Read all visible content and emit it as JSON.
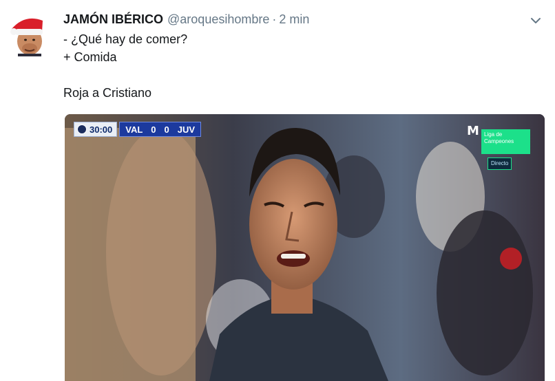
{
  "tweet": {
    "display_name": "JAMÓN IBÉRICO",
    "handle": "@aroquesihombre",
    "separator": "·",
    "time": "2 min",
    "lines": [
      "- ¿Qué hay de comer?",
      "+ Comida",
      "",
      "Roja a Cristiano"
    ]
  },
  "icons": {
    "avatar": "santa-hat-avatar",
    "menu": "chevron-down-icon"
  },
  "media": {
    "scorebug": {
      "clock": "30:00",
      "home": "VAL",
      "home_score": "0",
      "away_score": "0",
      "away": "JUV"
    },
    "broadcaster_logo": "M",
    "channel_box": "Liga de Campeones",
    "live_label": "Directo"
  },
  "colors": {
    "name": "#14171a",
    "muted": "#657786",
    "scorebug_blue": "#1c3a9e",
    "channel_green": "#1ce08a"
  }
}
